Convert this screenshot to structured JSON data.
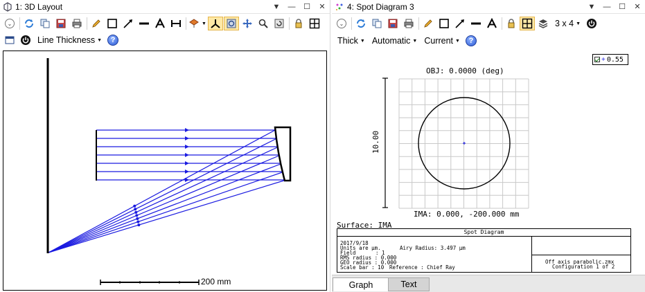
{
  "left_window": {
    "title": "1: 3D Layout",
    "toolbar2": {
      "line_thickness_label": "Line Thickness"
    },
    "scale_bar_label": "200 mm"
  },
  "right_window": {
    "title": "4: Spot Diagram 3",
    "toolbar1": {
      "grid_label": "3 x 4"
    },
    "toolbar2": {
      "thick_label": "Thick",
      "automatic_label": "Automatic",
      "current_label": "Current"
    },
    "plot": {
      "obj_label": "OBJ: 0.0000 (deg)",
      "ima_label": "IMA: 0.000, -200.000 mm",
      "axis_label": "10.00",
      "surface_label": "Surface: IMA",
      "legend_value": "0.55"
    },
    "info": {
      "header": "Spot Diagram",
      "date": "2017/9/18",
      "units": "Units are µm.",
      "airy": "Airy Radius: 3.497 µm",
      "field_label": "Field",
      "field_value": ":     1",
      "rms": "RMS radius :    0.000",
      "geo": "GEO radius :    0.000",
      "scale": "Scale bar  : 10",
      "reference": "Reference  : Chief Ray",
      "file": "Off axis parabolic.zmx",
      "config": "Configuration 1 of 2"
    },
    "tabs": [
      {
        "label": "Graph",
        "active": true
      },
      {
        "label": "Text",
        "active": false
      }
    ]
  },
  "colors": {
    "ray": "#1a1ae0",
    "accent_active": "#ffe9a6"
  }
}
